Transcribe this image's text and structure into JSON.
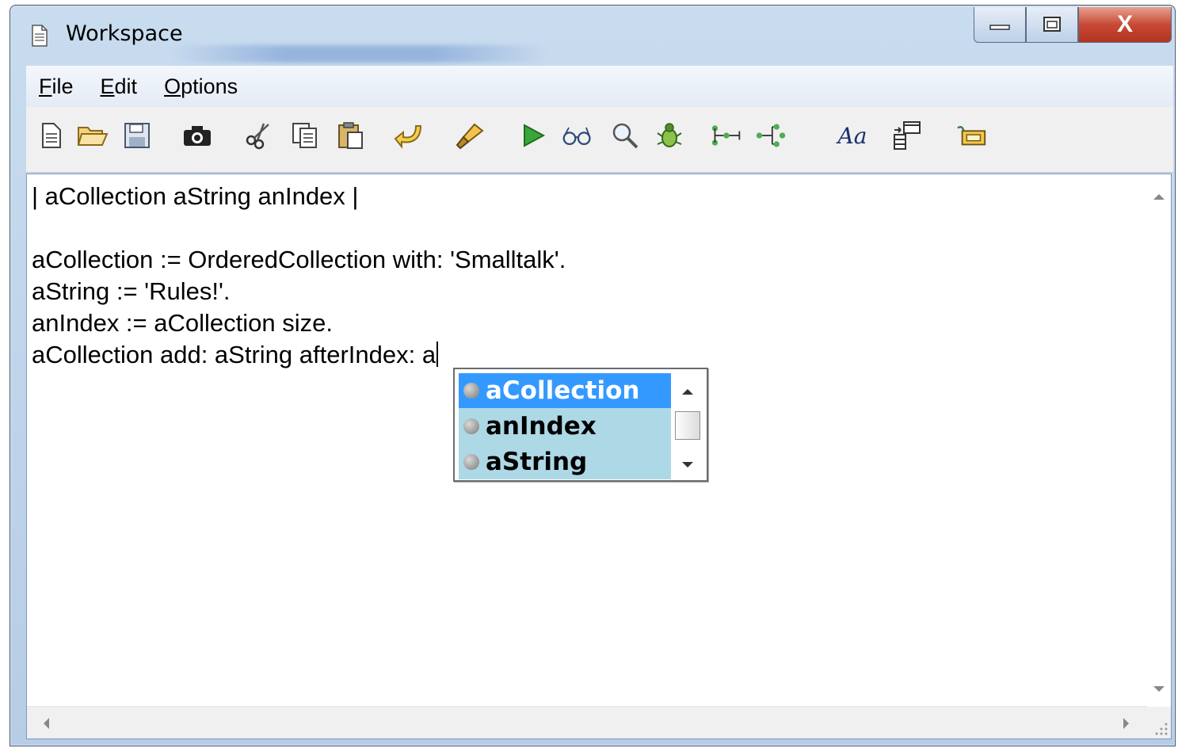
{
  "window": {
    "title": "Workspace",
    "controls": {
      "minimize": "minimize",
      "maximize": "maximize",
      "close": "X"
    }
  },
  "menubar": {
    "items": [
      {
        "label": "File",
        "underline": "F",
        "rest": "ile"
      },
      {
        "label": "Edit",
        "underline": "E",
        "rest": "dit"
      },
      {
        "label": "Options",
        "underline": "O",
        "rest": "ptions"
      }
    ]
  },
  "toolbar": {
    "icons": [
      "new-file-icon",
      "open-folder-icon",
      "save-icon",
      "camera-icon",
      "cut-icon",
      "copy-icon",
      "paste-icon",
      "undo-icon",
      "brush-icon",
      "run-icon",
      "inspect-glasses-icon",
      "find-icon",
      "debug-bug-icon",
      "browse-hierarchy-icon",
      "browse-references-icon",
      "font-icon",
      "format-icon",
      "class-browser-icon"
    ]
  },
  "editor": {
    "lines": [
      "| aCollection aString anIndex |",
      "",
      "aCollection := OrderedCollection with: 'Smalltalk'.",
      "aString := 'Rules!'.",
      "anIndex := aCollection size.",
      "aCollection add: aString afterIndex: a"
    ]
  },
  "autocomplete": {
    "items": [
      "aCollection",
      "anIndex",
      "aString"
    ],
    "selected": "aCollection",
    "colors": {
      "selected_bg": "#3399ff",
      "list_bg": "#add8e6"
    }
  }
}
